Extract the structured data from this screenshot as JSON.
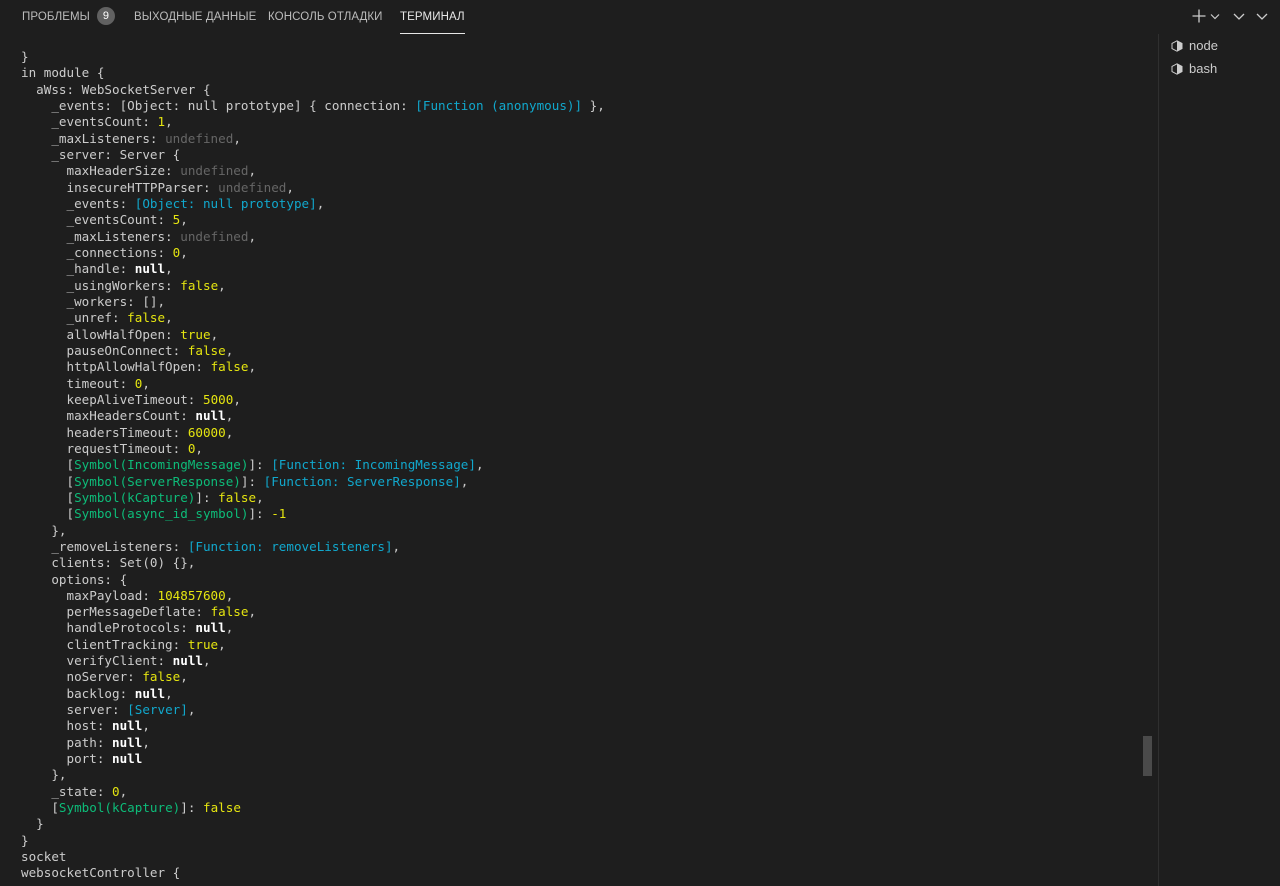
{
  "panel": {
    "tabs": [
      {
        "label": "ПРОБЛЕМЫ",
        "badge": "9"
      },
      {
        "label": "ВЫХОДНЫЕ ДАННЫЕ"
      },
      {
        "label": "КОНСОЛЬ ОТЛАДКИ"
      },
      {
        "label": "ТЕРМИНАЛ",
        "active": true
      }
    ],
    "actions": [
      "plus-icon",
      "chevron-down-icon",
      "chevron-down-icon"
    ]
  },
  "terminals": [
    {
      "label": "node",
      "icon": "terminal-cube-icon"
    },
    {
      "label": "bash",
      "icon": "terminal-cube-icon"
    }
  ],
  "colors": {
    "background": "#1e1e1e",
    "text": "#cccccc",
    "number_boolean": "#e5e510",
    "function_object": "#11a8cd",
    "symbol": "#0dbc79",
    "undefined": "#666666",
    "null": "#ffffff"
  },
  "terminal_output": [
    [
      [
        "def",
        "}"
      ]
    ],
    [
      [
        "def",
        "in module {"
      ]
    ],
    [
      [
        "def",
        "  aWss: WebSocketServer {"
      ]
    ],
    [
      [
        "def",
        "    _events: [Object: null prototype] { connection: "
      ],
      [
        "fn",
        "[Function (anonymous)]"
      ],
      [
        "def",
        " },"
      ]
    ],
    [
      [
        "def",
        "    _eventsCount: "
      ],
      [
        "num",
        "1"
      ],
      [
        "def",
        ","
      ]
    ],
    [
      [
        "def",
        "    _maxListeners: "
      ],
      [
        "und",
        "undefined"
      ],
      [
        "def",
        ","
      ]
    ],
    [
      [
        "def",
        "    _server: Server {"
      ]
    ],
    [
      [
        "def",
        "      maxHeaderSize: "
      ],
      [
        "und",
        "undefined"
      ],
      [
        "def",
        ","
      ]
    ],
    [
      [
        "def",
        "      insecureHTTPParser: "
      ],
      [
        "und",
        "undefined"
      ],
      [
        "def",
        ","
      ]
    ],
    [
      [
        "def",
        "      _events: "
      ],
      [
        "fn",
        "[Object: null prototype]"
      ],
      [
        "def",
        ","
      ]
    ],
    [
      [
        "def",
        "      _eventsCount: "
      ],
      [
        "num",
        "5"
      ],
      [
        "def",
        ","
      ]
    ],
    [
      [
        "def",
        "      _maxListeners: "
      ],
      [
        "und",
        "undefined"
      ],
      [
        "def",
        ","
      ]
    ],
    [
      [
        "def",
        "      _connections: "
      ],
      [
        "num",
        "0"
      ],
      [
        "def",
        ","
      ]
    ],
    [
      [
        "def",
        "      _handle: "
      ],
      [
        "null",
        "null"
      ],
      [
        "def",
        ","
      ]
    ],
    [
      [
        "def",
        "      _usingWorkers: "
      ],
      [
        "bool",
        "false"
      ],
      [
        "def",
        ","
      ]
    ],
    [
      [
        "def",
        "      _workers: [],"
      ]
    ],
    [
      [
        "def",
        "      _unref: "
      ],
      [
        "bool",
        "false"
      ],
      [
        "def",
        ","
      ]
    ],
    [
      [
        "def",
        "      allowHalfOpen: "
      ],
      [
        "bool",
        "true"
      ],
      [
        "def",
        ","
      ]
    ],
    [
      [
        "def",
        "      pauseOnConnect: "
      ],
      [
        "bool",
        "false"
      ],
      [
        "def",
        ","
      ]
    ],
    [
      [
        "def",
        "      httpAllowHalfOpen: "
      ],
      [
        "bool",
        "false"
      ],
      [
        "def",
        ","
      ]
    ],
    [
      [
        "def",
        "      timeout: "
      ],
      [
        "num",
        "0"
      ],
      [
        "def",
        ","
      ]
    ],
    [
      [
        "def",
        "      keepAliveTimeout: "
      ],
      [
        "num",
        "5000"
      ],
      [
        "def",
        ","
      ]
    ],
    [
      [
        "def",
        "      maxHeadersCount: "
      ],
      [
        "null",
        "null"
      ],
      [
        "def",
        ","
      ]
    ],
    [
      [
        "def",
        "      headersTimeout: "
      ],
      [
        "num",
        "60000"
      ],
      [
        "def",
        ","
      ]
    ],
    [
      [
        "def",
        "      requestTimeout: "
      ],
      [
        "num",
        "0"
      ],
      [
        "def",
        ","
      ]
    ],
    [
      [
        "def",
        "      ["
      ],
      [
        "sym",
        "Symbol(IncomingMessage)"
      ],
      [
        "def",
        "]: "
      ],
      [
        "fn",
        "[Function: IncomingMessage]"
      ],
      [
        "def",
        ","
      ]
    ],
    [
      [
        "def",
        "      ["
      ],
      [
        "sym",
        "Symbol(ServerResponse)"
      ],
      [
        "def",
        "]: "
      ],
      [
        "fn",
        "[Function: ServerResponse]"
      ],
      [
        "def",
        ","
      ]
    ],
    [
      [
        "def",
        "      ["
      ],
      [
        "sym",
        "Symbol(kCapture)"
      ],
      [
        "def",
        "]: "
      ],
      [
        "bool",
        "false"
      ],
      [
        "def",
        ","
      ]
    ],
    [
      [
        "def",
        "      ["
      ],
      [
        "sym",
        "Symbol(async_id_symbol)"
      ],
      [
        "def",
        "]: "
      ],
      [
        "num",
        "-1"
      ]
    ],
    [
      [
        "def",
        "    },"
      ]
    ],
    [
      [
        "def",
        "    _removeListeners: "
      ],
      [
        "fn",
        "[Function: removeListeners]"
      ],
      [
        "def",
        ","
      ]
    ],
    [
      [
        "def",
        "    clients: Set(0) {},"
      ]
    ],
    [
      [
        "def",
        "    options: {"
      ]
    ],
    [
      [
        "def",
        "      maxPayload: "
      ],
      [
        "num",
        "104857600"
      ],
      [
        "def",
        ","
      ]
    ],
    [
      [
        "def",
        "      perMessageDeflate: "
      ],
      [
        "bool",
        "false"
      ],
      [
        "def",
        ","
      ]
    ],
    [
      [
        "def",
        "      handleProtocols: "
      ],
      [
        "null",
        "null"
      ],
      [
        "def",
        ","
      ]
    ],
    [
      [
        "def",
        "      clientTracking: "
      ],
      [
        "bool",
        "true"
      ],
      [
        "def",
        ","
      ]
    ],
    [
      [
        "def",
        "      verifyClient: "
      ],
      [
        "null",
        "null"
      ],
      [
        "def",
        ","
      ]
    ],
    [
      [
        "def",
        "      noServer: "
      ],
      [
        "bool",
        "false"
      ],
      [
        "def",
        ","
      ]
    ],
    [
      [
        "def",
        "      backlog: "
      ],
      [
        "null",
        "null"
      ],
      [
        "def",
        ","
      ]
    ],
    [
      [
        "def",
        "      server: "
      ],
      [
        "fn",
        "[Server]"
      ],
      [
        "def",
        ","
      ]
    ],
    [
      [
        "def",
        "      host: "
      ],
      [
        "null",
        "null"
      ],
      [
        "def",
        ","
      ]
    ],
    [
      [
        "def",
        "      path: "
      ],
      [
        "null",
        "null"
      ],
      [
        "def",
        ","
      ]
    ],
    [
      [
        "def",
        "      port: "
      ],
      [
        "null",
        "null"
      ]
    ],
    [
      [
        "def",
        "    },"
      ]
    ],
    [
      [
        "def",
        "    _state: "
      ],
      [
        "num",
        "0"
      ],
      [
        "def",
        ","
      ]
    ],
    [
      [
        "def",
        "    ["
      ],
      [
        "sym",
        "Symbol(kCapture)"
      ],
      [
        "def",
        "]: "
      ],
      [
        "bool",
        "false"
      ]
    ],
    [
      [
        "def",
        "  }"
      ]
    ],
    [
      [
        "def",
        "}"
      ]
    ],
    [
      [
        "def",
        "socket"
      ]
    ],
    [
      [
        "def",
        "websocketController {"
      ]
    ]
  ]
}
